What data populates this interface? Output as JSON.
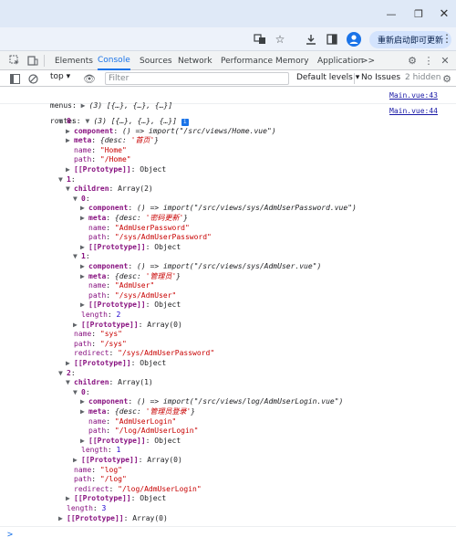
{
  "devtools": {
    "tabs": [
      "Elements",
      "Console",
      "Sources",
      "Network",
      "Performance",
      "Memory",
      "Application"
    ],
    "more": ">>",
    "active_tab": "Console"
  },
  "browser": {
    "update_label": "重新启动即可更新"
  },
  "console_toolbar": {
    "context": "top",
    "filter_placeholder": "Filter",
    "levels": "Default levels",
    "issues": "No Issues",
    "hidden": "2 hidden"
  },
  "messages": [
    {
      "label": "menus:",
      "summary": "(3) [{…}, {…}, {…}]",
      "source": "Main.vue:43"
    },
    {
      "label": "routes:",
      "summary": "(3) [{…}, {…}, {…}]",
      "source": "Main.vue:44"
    }
  ],
  "tree": [
    {
      "indent": 1,
      "arrow": "down",
      "key": "0",
      "sep": ":",
      "value": "",
      "vtype": ""
    },
    {
      "indent": 2,
      "arrow": "right",
      "key": "component",
      "sep": ": ",
      "value": "() => import(\"/src/views/Home.vue\")",
      "vtype": "fn"
    },
    {
      "indent": 2,
      "arrow": "right",
      "key": "meta",
      "sep": ": ",
      "value": "{desc: '首页'}",
      "vtype": "obj"
    },
    {
      "indent": 2,
      "arrow": "",
      "key": "name",
      "sep": ": ",
      "value": "\"Home\"",
      "vtype": "str"
    },
    {
      "indent": 2,
      "arrow": "",
      "key": "path",
      "sep": ": ",
      "value": "\"/Home\"",
      "vtype": "str"
    },
    {
      "indent": 2,
      "arrow": "right",
      "key": "[[Prototype]]",
      "sep": ": ",
      "value": "Object",
      "vtype": "plain"
    },
    {
      "indent": 1,
      "arrow": "down",
      "key": "1",
      "sep": ":",
      "value": "",
      "vtype": ""
    },
    {
      "indent": 2,
      "arrow": "down",
      "key": "children",
      "sep": ": ",
      "value": "Array(2)",
      "vtype": "plain"
    },
    {
      "indent": 3,
      "arrow": "down",
      "key": "0",
      "sep": ":",
      "value": "",
      "vtype": ""
    },
    {
      "indent": 4,
      "arrow": "right",
      "key": "component",
      "sep": ": ",
      "value": "() => import(\"/src/views/sys/AdmUserPassword.vue\")",
      "vtype": "fn"
    },
    {
      "indent": 4,
      "arrow": "right",
      "key": "meta",
      "sep": ": ",
      "value": "{desc: '密码更新'}",
      "vtype": "obj"
    },
    {
      "indent": 4,
      "arrow": "",
      "key": "name",
      "sep": ": ",
      "value": "\"AdmUserPassword\"",
      "vtype": "str"
    },
    {
      "indent": 4,
      "arrow": "",
      "key": "path",
      "sep": ": ",
      "value": "\"/sys/AdmUserPassword\"",
      "vtype": "str"
    },
    {
      "indent": 4,
      "arrow": "right",
      "key": "[[Prototype]]",
      "sep": ": ",
      "value": "Object",
      "vtype": "plain"
    },
    {
      "indent": 3,
      "arrow": "down",
      "key": "1",
      "sep": ":",
      "value": "",
      "vtype": ""
    },
    {
      "indent": 4,
      "arrow": "right",
      "key": "component",
      "sep": ": ",
      "value": "() => import(\"/src/views/sys/AdmUser.vue\")",
      "vtype": "fn"
    },
    {
      "indent": 4,
      "arrow": "right",
      "key": "meta",
      "sep": ": ",
      "value": "{desc: '管理员'}",
      "vtype": "obj"
    },
    {
      "indent": 4,
      "arrow": "",
      "key": "name",
      "sep": ": ",
      "value": "\"AdmUser\"",
      "vtype": "str"
    },
    {
      "indent": 4,
      "arrow": "",
      "key": "path",
      "sep": ": ",
      "value": "\"/sys/AdmUser\"",
      "vtype": "str"
    },
    {
      "indent": 4,
      "arrow": "right",
      "key": "[[Prototype]]",
      "sep": ": ",
      "value": "Object",
      "vtype": "plain"
    },
    {
      "indent": 3,
      "arrow": "",
      "key": "length",
      "sep": ": ",
      "value": "2",
      "vtype": "num"
    },
    {
      "indent": 3,
      "arrow": "right",
      "key": "[[Prototype]]",
      "sep": ": ",
      "value": "Array(0)",
      "vtype": "plain"
    },
    {
      "indent": 2,
      "arrow": "",
      "key": "name",
      "sep": ": ",
      "value": "\"sys\"",
      "vtype": "str"
    },
    {
      "indent": 2,
      "arrow": "",
      "key": "path",
      "sep": ": ",
      "value": "\"/sys\"",
      "vtype": "str"
    },
    {
      "indent": 2,
      "arrow": "",
      "key": "redirect",
      "sep": ": ",
      "value": "\"/sys/AdmUserPassword\"",
      "vtype": "str"
    },
    {
      "indent": 2,
      "arrow": "right",
      "key": "[[Prototype]]",
      "sep": ": ",
      "value": "Object",
      "vtype": "plain"
    },
    {
      "indent": 1,
      "arrow": "down",
      "key": "2",
      "sep": ":",
      "value": "",
      "vtype": ""
    },
    {
      "indent": 2,
      "arrow": "down",
      "key": "children",
      "sep": ": ",
      "value": "Array(1)",
      "vtype": "plain"
    },
    {
      "indent": 3,
      "arrow": "down",
      "key": "0",
      "sep": ":",
      "value": "",
      "vtype": ""
    },
    {
      "indent": 4,
      "arrow": "right",
      "key": "component",
      "sep": ": ",
      "value": "() => import(\"/src/views/log/AdmUserLogin.vue\")",
      "vtype": "fn"
    },
    {
      "indent": 4,
      "arrow": "right",
      "key": "meta",
      "sep": ": ",
      "value": "{desc: '管理员登录'}",
      "vtype": "obj"
    },
    {
      "indent": 4,
      "arrow": "",
      "key": "name",
      "sep": ": ",
      "value": "\"AdmUserLogin\"",
      "vtype": "str"
    },
    {
      "indent": 4,
      "arrow": "",
      "key": "path",
      "sep": ": ",
      "value": "\"/log/AdmUserLogin\"",
      "vtype": "str"
    },
    {
      "indent": 4,
      "arrow": "right",
      "key": "[[Prototype]]",
      "sep": ": ",
      "value": "Object",
      "vtype": "plain"
    },
    {
      "indent": 3,
      "arrow": "",
      "key": "length",
      "sep": ": ",
      "value": "1",
      "vtype": "num"
    },
    {
      "indent": 3,
      "arrow": "right",
      "key": "[[Prototype]]",
      "sep": ": ",
      "value": "Array(0)",
      "vtype": "plain"
    },
    {
      "indent": 2,
      "arrow": "",
      "key": "name",
      "sep": ": ",
      "value": "\"log\"",
      "vtype": "str"
    },
    {
      "indent": 2,
      "arrow": "",
      "key": "path",
      "sep": ": ",
      "value": "\"/log\"",
      "vtype": "str"
    },
    {
      "indent": 2,
      "arrow": "",
      "key": "redirect",
      "sep": ": ",
      "value": "\"/log/AdmUserLogin\"",
      "vtype": "str"
    },
    {
      "indent": 2,
      "arrow": "right",
      "key": "[[Prototype]]",
      "sep": ": ",
      "value": "Object",
      "vtype": "plain"
    },
    {
      "indent": 1,
      "arrow": "",
      "key": "length",
      "sep": ": ",
      "value": "3",
      "vtype": "num"
    },
    {
      "indent": 1,
      "arrow": "right",
      "key": "[[Prototype]]",
      "sep": ": ",
      "value": "Array(0)",
      "vtype": "plain"
    }
  ],
  "prompt_symbol": ">"
}
